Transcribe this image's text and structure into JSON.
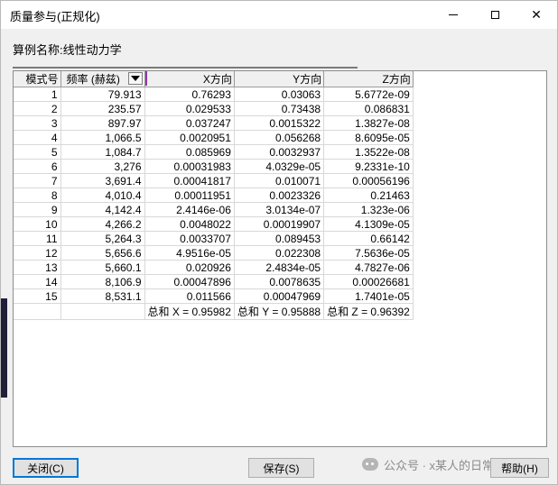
{
  "window": {
    "title": "质量参与(正规化)",
    "controls": {
      "minimize": "minimize",
      "maximize": "maximize",
      "close": "✕"
    }
  },
  "case_label": "算例名称:线性动力学",
  "table": {
    "headers": [
      "模式号",
      "频率 (赫兹)",
      "X方向",
      "Y方向",
      "Z方向"
    ],
    "rows": [
      [
        "1",
        "79.913",
        "0.76293",
        "0.03063",
        "5.6772e-09"
      ],
      [
        "2",
        "235.57",
        "0.029533",
        "0.73438",
        "0.086831"
      ],
      [
        "3",
        "897.97",
        "0.037247",
        "0.0015322",
        "1.3827e-08"
      ],
      [
        "4",
        "1,066.5",
        "0.0020951",
        "0.056268",
        "8.6095e-05"
      ],
      [
        "5",
        "1,084.7",
        "0.085969",
        "0.0032937",
        "1.3522e-08"
      ],
      [
        "6",
        "3,276",
        "0.00031983",
        "4.0329e-05",
        "9.2331e-10"
      ],
      [
        "7",
        "3,691.4",
        "0.00041817",
        "0.010071",
        "0.00056196"
      ],
      [
        "8",
        "4,010.4",
        "0.00011951",
        "0.0023326",
        "0.21463"
      ],
      [
        "9",
        "4,142.4",
        "2.4146e-06",
        "3.0134e-07",
        "1.323e-06"
      ],
      [
        "10",
        "4,266.2",
        "0.0048022",
        "0.00019907",
        "4.1309e-05"
      ],
      [
        "11",
        "5,264.3",
        "0.0033707",
        "0.089453",
        "0.66142"
      ],
      [
        "12",
        "5,656.6",
        "4.9516e-05",
        "0.022308",
        "7.5636e-05"
      ],
      [
        "13",
        "5,660.1",
        "0.020926",
        "2.4834e-05",
        "4.7827e-06"
      ],
      [
        "14",
        "8,106.9",
        "0.00047896",
        "0.0078635",
        "0.00026681"
      ],
      [
        "15",
        "8,531.1",
        "0.011566",
        "0.00047969",
        "1.7401e-05"
      ]
    ],
    "sums": [
      "总和 X = 0.95982",
      "总和 Y = 0.95888",
      "总和 Z = 0.96392"
    ]
  },
  "buttons": {
    "close": "关闭(C)",
    "save": "保存(S)",
    "help": "帮助(H)"
  },
  "watermark": "公众号 · x某人的日常",
  "colors": {
    "focus_border": "#0078d7",
    "accent": "#8a3aa8"
  }
}
